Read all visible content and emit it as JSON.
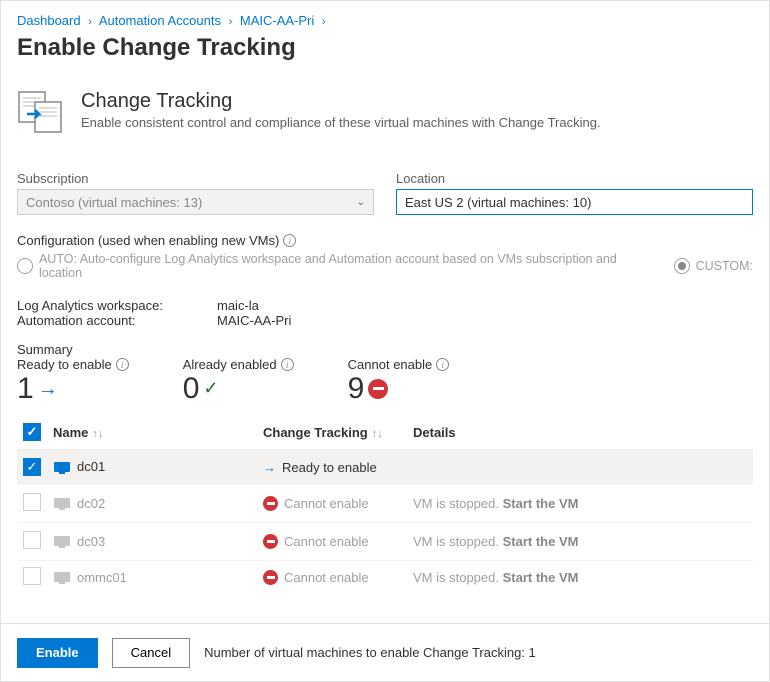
{
  "breadcrumb": [
    {
      "label": "Dashboard"
    },
    {
      "label": "Automation Accounts"
    },
    {
      "label": "MAIC-AA-Pri"
    }
  ],
  "page_title": "Enable Change Tracking",
  "hero": {
    "title": "Change Tracking",
    "subtitle": "Enable consistent control and compliance of these virtual machines with Change Tracking."
  },
  "subscription": {
    "label": "Subscription",
    "value": "Contoso (virtual machines: 13)"
  },
  "location": {
    "label": "Location",
    "value": "East US 2 (virtual machines: 10)"
  },
  "config": {
    "label": "Configuration (used when enabling new VMs)",
    "auto_label": "AUTO: Auto-configure Log Analytics workspace and Automation account based on VMs subscription and location",
    "custom_label": "CUSTOM:"
  },
  "workspace": {
    "la_label": "Log Analytics workspace:",
    "la_value": "maic-la",
    "aa_label": "Automation account:",
    "aa_value": "MAIC-AA-Pri"
  },
  "summary": {
    "label": "Summary",
    "ready": {
      "label": "Ready to enable",
      "value": "1"
    },
    "already": {
      "label": "Already enabled",
      "value": "0"
    },
    "cannot": {
      "label": "Cannot enable",
      "value": "9"
    }
  },
  "table": {
    "headers": {
      "name": "Name",
      "ct": "Change Tracking",
      "details": "Details"
    },
    "rows": [
      {
        "name": "dc01",
        "status": "ready",
        "status_text": "Ready to enable",
        "details": "",
        "action": "",
        "selected": true,
        "enabled": true
      },
      {
        "name": "dc02",
        "status": "cannot",
        "status_text": "Cannot enable",
        "details": "VM is stopped.",
        "action": "Start the VM",
        "selected": false,
        "enabled": false
      },
      {
        "name": "dc03",
        "status": "cannot",
        "status_text": "Cannot enable",
        "details": "VM is stopped.",
        "action": "Start the VM",
        "selected": false,
        "enabled": false
      },
      {
        "name": "ommc01",
        "status": "cannot",
        "status_text": "Cannot enable",
        "details": "VM is stopped.",
        "action": "Start the VM",
        "selected": false,
        "enabled": false
      }
    ]
  },
  "footer": {
    "enable": "Enable",
    "cancel": "Cancel",
    "status": "Number of virtual machines to enable Change Tracking: 1"
  }
}
